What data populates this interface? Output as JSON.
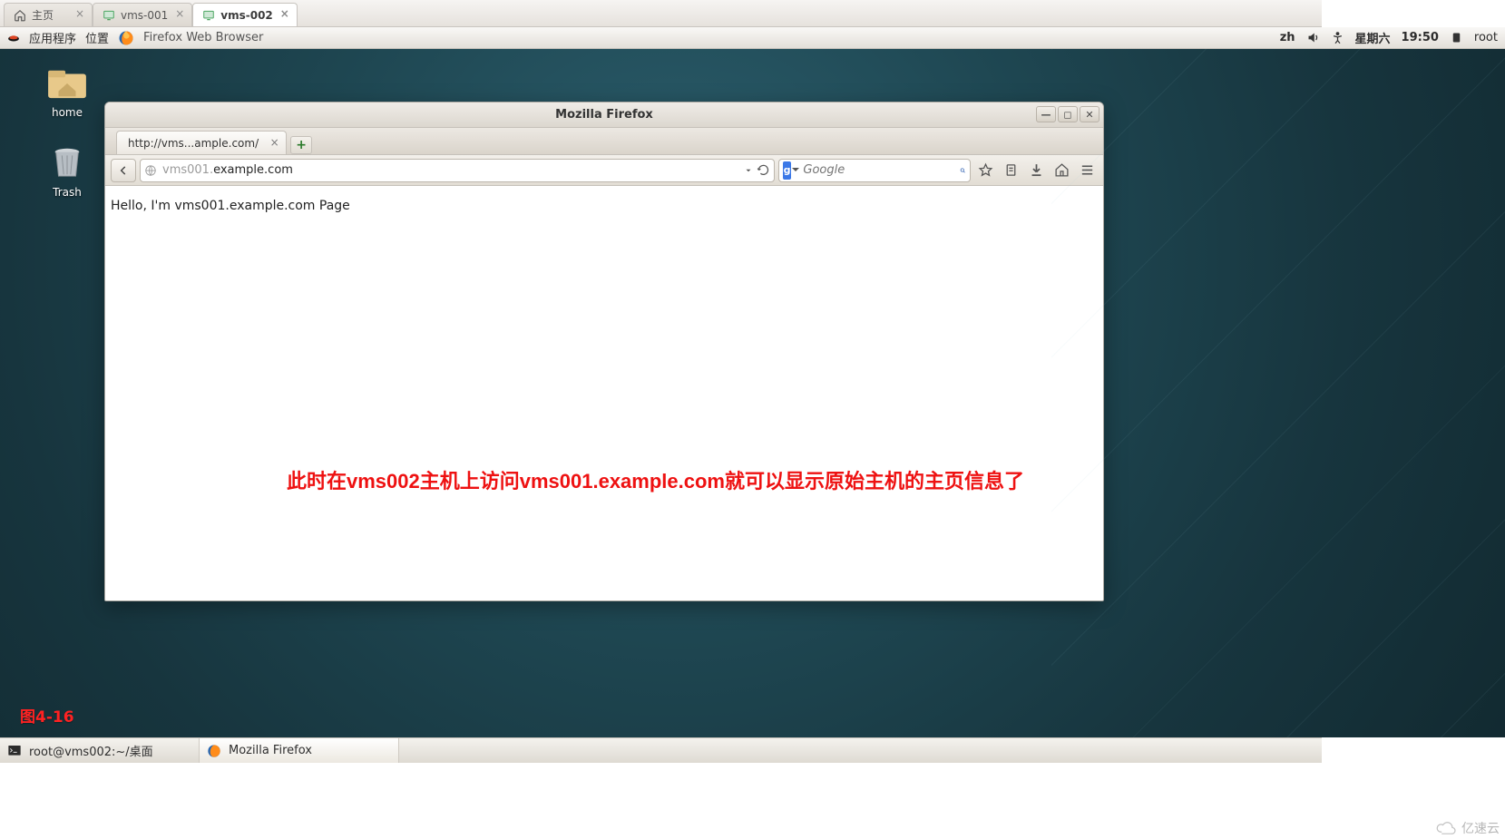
{
  "outer_tabs": [
    {
      "label": "主页",
      "icon": "home"
    },
    {
      "label": "vms-001",
      "icon": "vm"
    },
    {
      "label": "vms-002",
      "icon": "vm"
    }
  ],
  "outer_active_index": 2,
  "gnome": {
    "apps": "应用程序",
    "places": "位置",
    "active_app": "Firefox Web Browser",
    "input_method": "zh",
    "day": "星期六",
    "time": "19:50",
    "user": "root"
  },
  "desktop_icons": {
    "home": "home",
    "trash": "Trash"
  },
  "figure_label": "图4-16",
  "firefox": {
    "title": "Mozilla Firefox",
    "tab_label": "http://vms...ample.com/",
    "url_dim_prefix": "vms001.",
    "url_rest": "example.com",
    "search_engine_letter": "g",
    "search_placeholder": "Google",
    "page_text": "Hello, I'm vms001.example.com Page",
    "annotation": "此时在vms002主机上访问vms001.example.com就可以显示原始主机的主页信息了"
  },
  "taskbar": {
    "term_label": "root@vms002:~/桌面",
    "ff_label": "Mozilla Firefox"
  },
  "watermark_text": "亿速云"
}
